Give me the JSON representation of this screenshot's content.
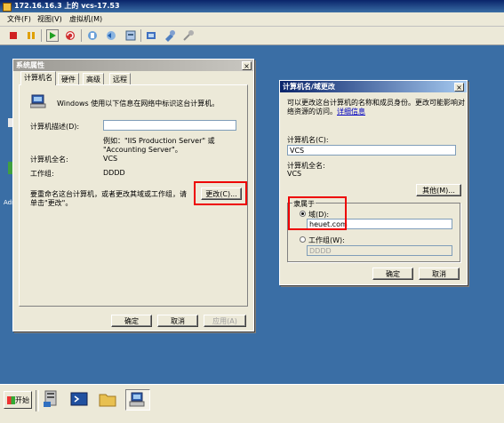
{
  "vm_window": {
    "title": "172.16.16.3 上的 vcs-17.53"
  },
  "menu": {
    "items": [
      "文件(F)",
      "视图(V)",
      "虚拟机(M)"
    ]
  },
  "toolbar": {
    "buttons": [
      "stop-icon",
      "pause-icon",
      "play-icon",
      "reset-icon",
      "snapshot-icon",
      "revert-icon",
      "manage-snapshot-icon",
      "send-icon",
      "settings-icon",
      "connect-icon"
    ]
  },
  "desktop": {
    "icon_text": "Adm"
  },
  "system_properties": {
    "title": "系统属性",
    "tabs": [
      "计算机名",
      "硬件",
      "高级",
      "远程"
    ],
    "intro": "Windows 使用以下信息在网络中标识这台计算机。",
    "description_label": "计算机描述(D):",
    "description_value": "",
    "example_line1": "例如：\"IIS Production Server\" 或",
    "example_line2": "\"Accounting Server\"。",
    "fullname_label": "计算机全名:",
    "fullname_value": "VCS",
    "workgroup_label": "工作组:",
    "workgroup_value": "DDDD",
    "rename_text_line1": "要重命名这台计算机，或者更改其域或工作组，请",
    "rename_text_line2": "单击\"更改\"。",
    "change_button": "更改(C)...",
    "ok": "确定",
    "cancel": "取消",
    "apply": "应用(A)"
  },
  "name_change": {
    "title": "计算机名/域更改",
    "intro_line1": "可以更改这台计算机的名称和成员身份。更改可能影响对",
    "intro_line2": "络资源的访问。",
    "details_link": "详细信息",
    "name_label": "计算机名(C):",
    "name_value": "VCS",
    "fullname_label": "计算机全名:",
    "fullname_value": "VCS",
    "other_button": "其他(M)...",
    "member_of": "隶属于",
    "domain_label": "域(D):",
    "domain_value": "heuet.com",
    "workgroup_label": "工作组(W):",
    "workgroup_value": "DDDD",
    "ok": "确定",
    "cancel": "取消"
  },
  "taskbar": {
    "start": "开始"
  },
  "colors": {
    "highlight_box": "#e00000",
    "desktop": "#3a6ea5",
    "dialog_bg": "#ece9d8"
  }
}
